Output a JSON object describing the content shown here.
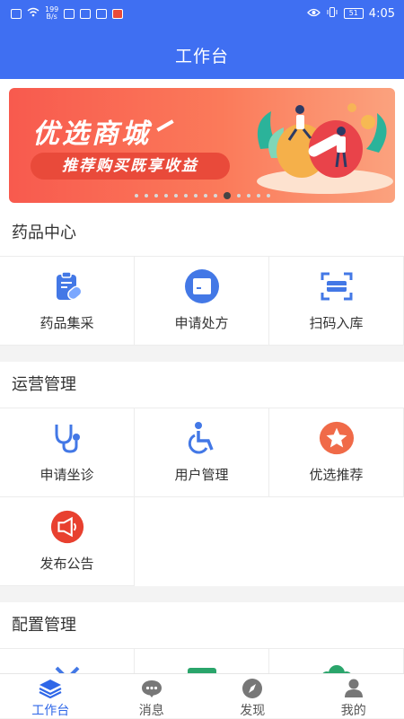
{
  "status_bar": {
    "speed_value": "199",
    "speed_unit": "B/s",
    "battery": "51",
    "time": "4:05"
  },
  "header": {
    "title": "工作台"
  },
  "banner": {
    "title": "优选商城",
    "subtitle": "推荐购买既享收益",
    "dot_count": 14,
    "active_dot": 9
  },
  "sections": [
    {
      "title": "药品中心",
      "items": [
        {
          "label": "药品集采",
          "icon": "medicine-clipboard-icon"
        },
        {
          "label": "申请处方",
          "icon": "prescription-icon"
        },
        {
          "label": "扫码入库",
          "icon": "scan-icon"
        }
      ]
    },
    {
      "title": "运营管理",
      "items": [
        {
          "label": "申请坐诊",
          "icon": "stethoscope-icon"
        },
        {
          "label": "用户管理",
          "icon": "wheelchair-icon"
        },
        {
          "label": "优选推荐",
          "icon": "star-badge-icon"
        },
        {
          "label": "发布公告",
          "icon": "announcement-icon"
        }
      ]
    },
    {
      "title": "配置管理",
      "items": []
    }
  ],
  "tabbar": [
    {
      "label": "工作台",
      "icon": "layers-icon",
      "active": true
    },
    {
      "label": "消息",
      "icon": "message-icon",
      "active": false
    },
    {
      "label": "发现",
      "icon": "compass-icon",
      "active": false
    },
    {
      "label": "我的",
      "icon": "profile-icon",
      "active": false
    }
  ],
  "colors": {
    "primary": "#3f6ff2",
    "banner": "#f85a4e",
    "tab_active": "#2f67e8",
    "icon_blue": "#4378e6",
    "icon_red": "#e84a3a"
  }
}
